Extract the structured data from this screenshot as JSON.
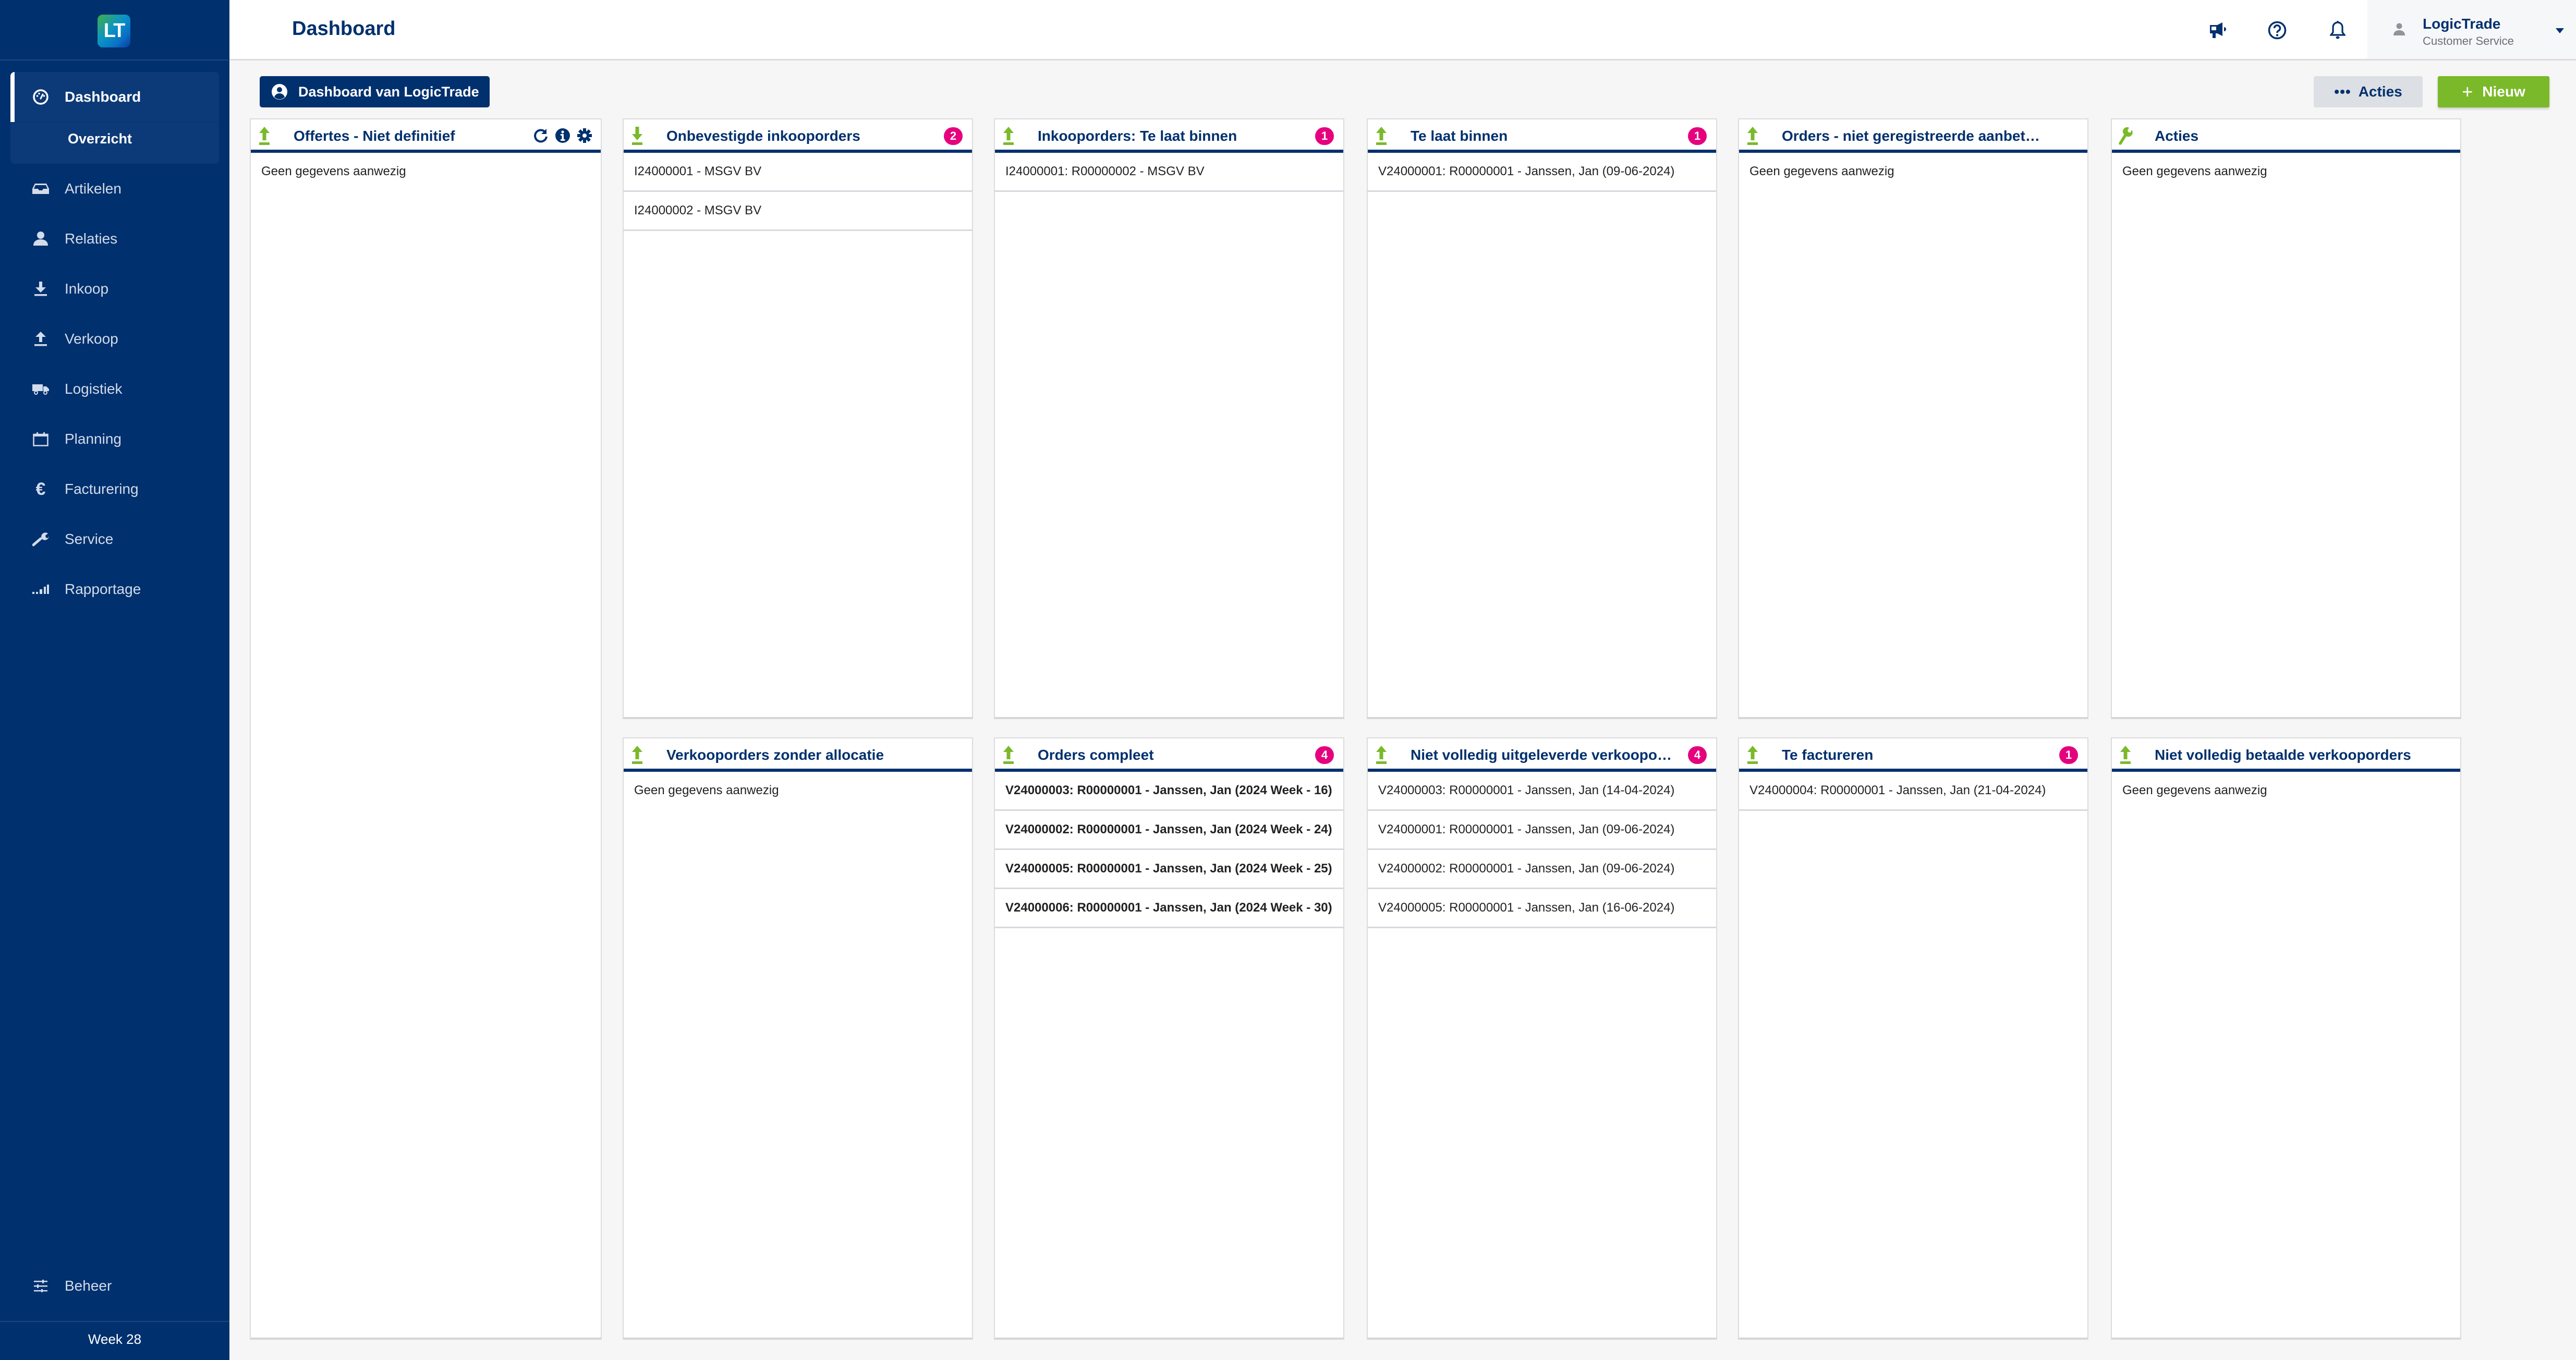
{
  "app": {
    "logo_text": "LT",
    "page_title": "Dashboard",
    "week_label": "Week 28"
  },
  "sidebar": {
    "items": [
      {
        "label": "Dashboard",
        "icon": "gauge-icon",
        "active": true
      },
      {
        "label": "Artikelen",
        "icon": "inbox-icon"
      },
      {
        "label": "Relaties",
        "icon": "user-icon"
      },
      {
        "label": "Inkoop",
        "icon": "download-icon"
      },
      {
        "label": "Verkoop",
        "icon": "upload-icon"
      },
      {
        "label": "Logistiek",
        "icon": "truck-icon"
      },
      {
        "label": "Planning",
        "icon": "calendar-icon"
      },
      {
        "label": "Facturering",
        "icon": "euro-icon"
      },
      {
        "label": "Service",
        "icon": "wrench-icon"
      },
      {
        "label": "Rapportage",
        "icon": "signal-bars-icon"
      }
    ],
    "sub_item": "Overzicht",
    "bottom_item": {
      "label": "Beheer",
      "icon": "sliders-icon"
    }
  },
  "topbar": {
    "icons": [
      "megaphone-icon",
      "help-circle-icon",
      "bell-icon"
    ],
    "user": {
      "name": "LogicTrade",
      "role": "Customer Service"
    }
  },
  "toolbar": {
    "dashboard_owner_label": "Dashboard van LogicTrade",
    "acties_label": "Acties",
    "nieuw_label": "Nieuw"
  },
  "colors": {
    "brand_navy": "#00306e",
    "accent_green": "#7ab929",
    "badge_magenta": "#e5007e"
  },
  "empty_text": "Geen gegevens aanwezig",
  "widgets": [
    {
      "title": "Offertes - Niet definitief",
      "icon": "upload-icon",
      "badge": null,
      "tools": [
        "refresh-icon",
        "info-icon",
        "gear-icon"
      ],
      "rows": [],
      "bold": false
    },
    {
      "title": "Onbevestigde inkooporders",
      "icon": "download-icon",
      "badge": "2",
      "rows": [
        "I24000001 - MSGV BV",
        "I24000002 - MSGV BV"
      ],
      "bold": false
    },
    {
      "title": "Inkooporders: Te laat binnen",
      "icon": "upload-icon",
      "badge": "1",
      "rows": [
        "I24000001: R00000002 - MSGV BV"
      ],
      "bold": false
    },
    {
      "title": "Te laat binnen",
      "icon": "upload-icon",
      "badge": "1",
      "rows": [
        "V24000001: R00000001 - Janssen, Jan (09-06-2024)"
      ],
      "bold": false
    },
    {
      "title": "Orders - niet geregistreerde aanbetalingen",
      "icon": "upload-icon",
      "badge": null,
      "rows": [],
      "bold": false
    },
    {
      "title": "Acties",
      "icon": "wrench-icon",
      "badge": null,
      "rows": [],
      "bold": false
    },
    {
      "title": "Verkooporders zonder allocatie",
      "icon": "upload-icon",
      "badge": null,
      "rows": [],
      "bold": false
    },
    {
      "title": "Orders compleet",
      "icon": "upload-icon",
      "badge": "4",
      "rows": [
        "V24000003: R00000001 - Janssen, Jan (2024 Week - 16)",
        "V24000002: R00000001 - Janssen, Jan (2024 Week - 24)",
        "V24000005: R00000001 - Janssen, Jan (2024 Week - 25)",
        "V24000006: R00000001 - Janssen, Jan (2024 Week - 30)"
      ],
      "bold": true
    },
    {
      "title": "Niet volledig uitgeleverde verkooporders",
      "icon": "upload-icon",
      "badge": "4",
      "rows": [
        "V24000003: R00000001 - Janssen, Jan (14-04-2024)",
        "V24000001: R00000001 - Janssen, Jan (09-06-2024)",
        "V24000002: R00000001 - Janssen, Jan (09-06-2024)",
        "V24000005: R00000001 - Janssen, Jan (16-06-2024)"
      ],
      "bold": false
    },
    {
      "title": "Te factureren",
      "icon": "upload-icon",
      "badge": "1",
      "rows": [
        "V24000004: R00000001 - Janssen, Jan (21-04-2024)"
      ],
      "bold": false
    },
    {
      "title": "Niet volledig betaalde verkooporders",
      "icon": "upload-icon",
      "badge": null,
      "rows": [],
      "bold": false
    }
  ]
}
